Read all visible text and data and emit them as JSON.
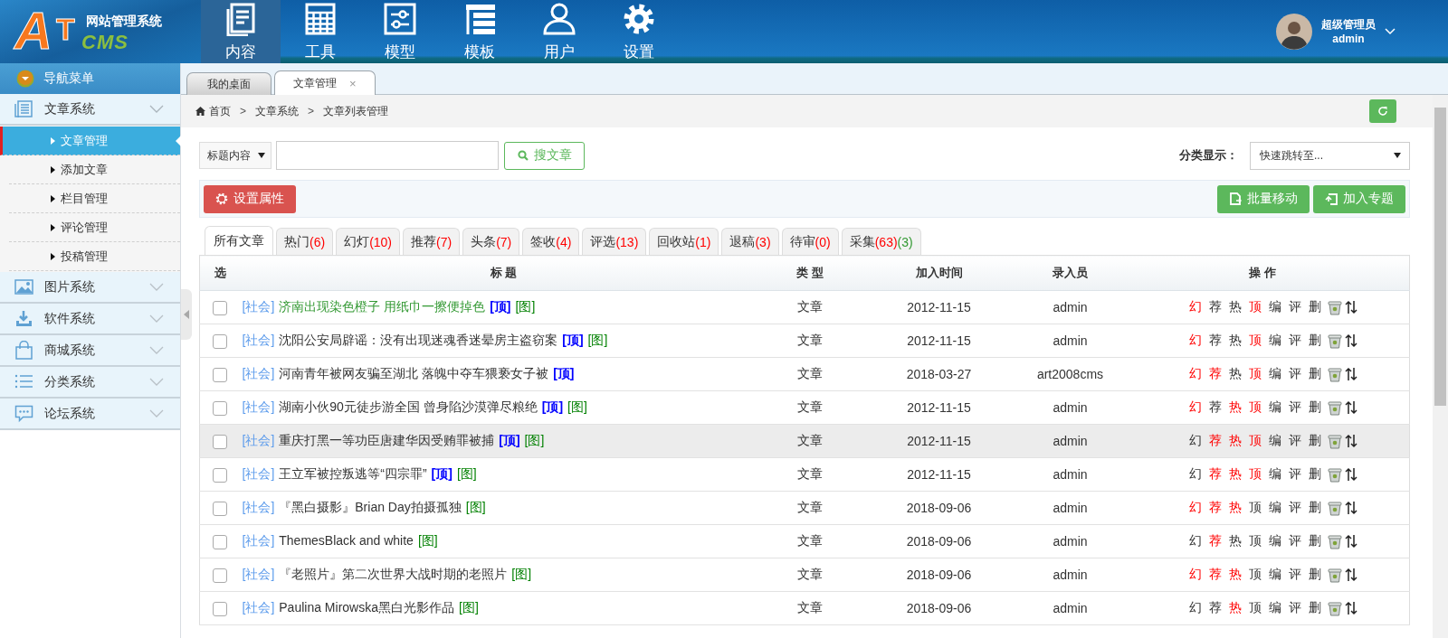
{
  "header": {
    "logo": {
      "letter_a": "A",
      "letter_t": "T",
      "cms": "CMS",
      "title": "网站管理系统"
    },
    "nav": [
      {
        "label": "内容",
        "selected": true
      },
      {
        "label": "工具",
        "selected": false
      },
      {
        "label": "模型",
        "selected": false
      },
      {
        "label": "模板",
        "selected": false
      },
      {
        "label": "用户",
        "selected": false
      },
      {
        "label": "设置",
        "selected": false
      }
    ],
    "user": {
      "role": "超级管理员",
      "name": "admin"
    }
  },
  "sidebar": {
    "title": "导航菜单",
    "groups": [
      {
        "label": "文章系统",
        "expanded": true,
        "children": [
          {
            "label": "文章管理",
            "selected": true
          },
          {
            "label": "添加文章",
            "selected": false
          },
          {
            "label": "栏目管理",
            "selected": false
          },
          {
            "label": "评论管理",
            "selected": false
          },
          {
            "label": "投稿管理",
            "selected": false
          }
        ]
      },
      {
        "label": "图片系统",
        "expanded": false
      },
      {
        "label": "软件系统",
        "expanded": false
      },
      {
        "label": "商城系统",
        "expanded": false
      },
      {
        "label": "分类系统",
        "expanded": false
      },
      {
        "label": "论坛系统",
        "expanded": false
      }
    ]
  },
  "tabs": [
    {
      "label": "我的桌面",
      "selected": false
    },
    {
      "label": "文章管理",
      "selected": true,
      "close": "×"
    }
  ],
  "breadcrumb": [
    {
      "text": "首页",
      "kind": "home"
    },
    {
      "text": ">",
      "kind": "sep"
    },
    {
      "text": "文章系统",
      "kind": "link"
    },
    {
      "text": ">",
      "kind": "sep"
    },
    {
      "text": "文章列表管理",
      "kind": "current"
    }
  ],
  "search": {
    "field_select": "标题内容",
    "button": "搜文章",
    "category_label": "分类显示：",
    "category_select": "快速跳转至..."
  },
  "actions": {
    "left": [
      {
        "label": "设置属性"
      }
    ],
    "right": [
      {
        "label": "批量移动"
      },
      {
        "label": "加入专题"
      }
    ]
  },
  "filter_tabs": [
    {
      "label": "所有文章",
      "selected": true
    },
    {
      "label": "热门",
      "selected": false,
      "counts": [
        {
          "text": "(6)",
          "color": "#ff0000"
        }
      ]
    },
    {
      "label": "幻灯",
      "selected": false,
      "counts": [
        {
          "text": "(10)",
          "color": "#ff0000"
        }
      ]
    },
    {
      "label": "推荐",
      "selected": false,
      "counts": [
        {
          "text": "(7)",
          "color": "#ff0000"
        }
      ]
    },
    {
      "label": "头条",
      "selected": false,
      "counts": [
        {
          "text": "(7)",
          "color": "#ff0000"
        }
      ]
    },
    {
      "label": "签收",
      "selected": false,
      "counts": [
        {
          "text": "(4)",
          "color": "#ff0000"
        }
      ]
    },
    {
      "label": "评选",
      "selected": false,
      "counts": [
        {
          "text": "(13)",
          "color": "#ff0000"
        }
      ]
    },
    {
      "label": "回收站",
      "selected": false,
      "counts": [
        {
          "text": "(1)",
          "color": "#ff0000"
        }
      ]
    },
    {
      "label": "退稿",
      "selected": false,
      "counts": [
        {
          "text": "(3)",
          "color": "#ff0000"
        }
      ]
    },
    {
      "label": "待审",
      "selected": false,
      "counts": [
        {
          "text": "(0)",
          "color": "#ff0000"
        }
      ]
    },
    {
      "label": "采集",
      "selected": false,
      "counts": [
        {
          "text": "(63)",
          "color": "#ff0000"
        },
        {
          "text": "(3)",
          "color": "#339933"
        }
      ]
    }
  ],
  "table": {
    "columns": [
      "选",
      "标 题",
      "类 型",
      "加入时间",
      "录入员",
      "操 作"
    ],
    "rows": [
      {
        "checked": false,
        "highlighted": false,
        "category": "[社会]",
        "title": "济南出现染色橙子 用纸巾一擦便掉色",
        "color": "#339933",
        "marks": [
          {
            "text": "[顶]",
            "kind": "top"
          },
          {
            "text": "[图]",
            "kind": "pic"
          }
        ],
        "type": "文章",
        "date": "2012-11-15",
        "author": "admin",
        "ops": [
          {
            "label": "幻",
            "on": true
          },
          {
            "label": "荐",
            "on": false
          },
          {
            "label": "热",
            "on": false
          },
          {
            "label": "顶",
            "on": true
          },
          {
            "label": "编",
            "on": false
          },
          {
            "label": "评",
            "on": false
          },
          {
            "label": "删",
            "on": false
          }
        ]
      },
      {
        "checked": false,
        "highlighted": false,
        "category": "[社会]",
        "title": "沈阳公安局辟谣：没有出现迷魂香迷晕房主盗窃案",
        "color": "#333333",
        "marks": [
          {
            "text": "[顶]",
            "kind": "top"
          },
          {
            "text": "[图]",
            "kind": "pic"
          }
        ],
        "type": "文章",
        "date": "2012-11-15",
        "author": "admin",
        "ops": [
          {
            "label": "幻",
            "on": true
          },
          {
            "label": "荐",
            "on": false
          },
          {
            "label": "热",
            "on": false
          },
          {
            "label": "顶",
            "on": true
          },
          {
            "label": "编",
            "on": false
          },
          {
            "label": "评",
            "on": false
          },
          {
            "label": "删",
            "on": false
          }
        ]
      },
      {
        "checked": false,
        "highlighted": false,
        "category": "[社会]",
        "title": "河南青年被网友骗至湖北 落魄中夺车猥亵女子被",
        "color": "#333333",
        "marks": [
          {
            "text": "[顶]",
            "kind": "top"
          }
        ],
        "type": "文章",
        "date": "2018-03-27",
        "author": "art2008cms",
        "ops": [
          {
            "label": "幻",
            "on": true
          },
          {
            "label": "荐",
            "on": true
          },
          {
            "label": "热",
            "on": false
          },
          {
            "label": "顶",
            "on": true
          },
          {
            "label": "编",
            "on": false
          },
          {
            "label": "评",
            "on": false
          },
          {
            "label": "删",
            "on": false
          }
        ]
      },
      {
        "checked": false,
        "highlighted": false,
        "category": "[社会]",
        "title": "湖南小伙90元徒步游全国 曾身陷沙漠弹尽粮绝",
        "color": "#333333",
        "marks": [
          {
            "text": "[顶]",
            "kind": "top"
          },
          {
            "text": "[图]",
            "kind": "pic"
          }
        ],
        "type": "文章",
        "date": "2012-11-15",
        "author": "admin",
        "ops": [
          {
            "label": "幻",
            "on": true
          },
          {
            "label": "荐",
            "on": false
          },
          {
            "label": "热",
            "on": true
          },
          {
            "label": "顶",
            "on": true
          },
          {
            "label": "编",
            "on": false
          },
          {
            "label": "评",
            "on": false
          },
          {
            "label": "删",
            "on": false
          }
        ]
      },
      {
        "checked": false,
        "highlighted": true,
        "category": "[社会]",
        "title": "重庆打黑一等功臣唐建华因受贿罪被捕",
        "color": "#333333",
        "marks": [
          {
            "text": "[顶]",
            "kind": "top"
          },
          {
            "text": "[图]",
            "kind": "pic"
          }
        ],
        "type": "文章",
        "date": "2012-11-15",
        "author": "admin",
        "ops": [
          {
            "label": "幻",
            "on": false
          },
          {
            "label": "荐",
            "on": true
          },
          {
            "label": "热",
            "on": true
          },
          {
            "label": "顶",
            "on": true
          },
          {
            "label": "编",
            "on": false
          },
          {
            "label": "评",
            "on": false
          },
          {
            "label": "删",
            "on": false
          }
        ]
      },
      {
        "checked": false,
        "highlighted": false,
        "category": "[社会]",
        "title": "王立军被控叛逃等“四宗罪”",
        "color": "#333333",
        "marks": [
          {
            "text": "[顶]",
            "kind": "top"
          },
          {
            "text": "[图]",
            "kind": "pic"
          }
        ],
        "type": "文章",
        "date": "2012-11-15",
        "author": "admin",
        "ops": [
          {
            "label": "幻",
            "on": false
          },
          {
            "label": "荐",
            "on": true
          },
          {
            "label": "热",
            "on": true
          },
          {
            "label": "顶",
            "on": true
          },
          {
            "label": "编",
            "on": false
          },
          {
            "label": "评",
            "on": false
          },
          {
            "label": "删",
            "on": false
          }
        ]
      },
      {
        "checked": false,
        "highlighted": false,
        "category": "[社会]",
        "title": "『黑白摄影』Brian Day拍摄孤独",
        "color": "#333333",
        "marks": [
          {
            "text": "[图]",
            "kind": "pic"
          }
        ],
        "type": "文章",
        "date": "2018-09-06",
        "author": "admin",
        "ops": [
          {
            "label": "幻",
            "on": true
          },
          {
            "label": "荐",
            "on": true
          },
          {
            "label": "热",
            "on": true
          },
          {
            "label": "顶",
            "on": false
          },
          {
            "label": "编",
            "on": false
          },
          {
            "label": "评",
            "on": false
          },
          {
            "label": "删",
            "on": false
          }
        ]
      },
      {
        "checked": false,
        "highlighted": false,
        "category": "[社会]",
        "title": "ThemesBlack and white",
        "color": "#333333",
        "marks": [
          {
            "text": "[图]",
            "kind": "pic"
          }
        ],
        "type": "文章",
        "date": "2018-09-06",
        "author": "admin",
        "ops": [
          {
            "label": "幻",
            "on": false
          },
          {
            "label": "荐",
            "on": true
          },
          {
            "label": "热",
            "on": false
          },
          {
            "label": "顶",
            "on": false
          },
          {
            "label": "编",
            "on": false
          },
          {
            "label": "评",
            "on": false
          },
          {
            "label": "删",
            "on": false
          }
        ]
      },
      {
        "checked": false,
        "highlighted": false,
        "category": "[社会]",
        "title": "『老照片』第二次世界大战时期的老照片",
        "color": "#333333",
        "marks": [
          {
            "text": "[图]",
            "kind": "pic"
          }
        ],
        "type": "文章",
        "date": "2018-09-06",
        "author": "admin",
        "ops": [
          {
            "label": "幻",
            "on": true
          },
          {
            "label": "荐",
            "on": true
          },
          {
            "label": "热",
            "on": true
          },
          {
            "label": "顶",
            "on": false
          },
          {
            "label": "编",
            "on": false
          },
          {
            "label": "评",
            "on": false
          },
          {
            "label": "删",
            "on": false
          }
        ]
      },
      {
        "checked": false,
        "highlighted": false,
        "category": "[社会]",
        "title": "Paulina Mirowska黑白光影作品",
        "color": "#333333",
        "marks": [
          {
            "text": "[图]",
            "kind": "pic"
          }
        ],
        "type": "文章",
        "date": "2018-09-06",
        "author": "admin",
        "ops": [
          {
            "label": "幻",
            "on": false
          },
          {
            "label": "荐",
            "on": false
          },
          {
            "label": "热",
            "on": true
          },
          {
            "label": "顶",
            "on": false
          },
          {
            "label": "编",
            "on": false
          },
          {
            "label": "评",
            "on": false
          },
          {
            "label": "删",
            "on": false
          }
        ]
      }
    ]
  }
}
